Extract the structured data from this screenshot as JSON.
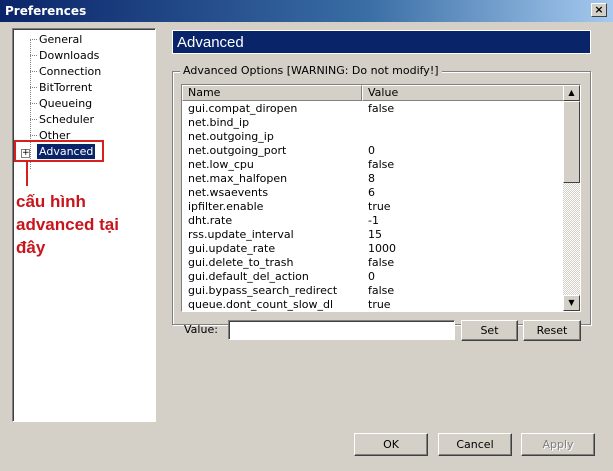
{
  "window": {
    "title": "Preferences",
    "close_glyph": "×"
  },
  "tree": {
    "items": [
      {
        "label": "General"
      },
      {
        "label": "Downloads"
      },
      {
        "label": "Connection"
      },
      {
        "label": "BitTorrent"
      },
      {
        "label": "Queueing"
      },
      {
        "label": "Scheduler"
      },
      {
        "label": "Other"
      },
      {
        "label": "Advanced",
        "selected": true
      }
    ],
    "expander_glyph": "+"
  },
  "annotation": {
    "text_line1": "cấu hình",
    "text_line2": "advanced tại",
    "text_line3": "đây",
    "color": "#c8151b"
  },
  "header": {
    "title": "Advanced"
  },
  "options": {
    "group_title": "Advanced Options [WARNING: Do not modify!]",
    "columns": {
      "name": "Name",
      "value": "Value"
    },
    "rows": [
      {
        "name": "gui.compat_diropen",
        "value": "false"
      },
      {
        "name": "net.bind_ip",
        "value": ""
      },
      {
        "name": "net.outgoing_ip",
        "value": ""
      },
      {
        "name": "net.outgoing_port",
        "value": "0"
      },
      {
        "name": "net.low_cpu",
        "value": "false"
      },
      {
        "name": "net.max_halfopen",
        "value": "8"
      },
      {
        "name": "net.wsaevents",
        "value": "6"
      },
      {
        "name": "ipfilter.enable",
        "value": "true"
      },
      {
        "name": "dht.rate",
        "value": "-1"
      },
      {
        "name": "rss.update_interval",
        "value": "15"
      },
      {
        "name": "gui.update_rate",
        "value": "1000"
      },
      {
        "name": "gui.delete_to_trash",
        "value": "false"
      },
      {
        "name": "gui.default_del_action",
        "value": "0"
      },
      {
        "name": "gui.bypass_search_redirect",
        "value": "false"
      },
      {
        "name": "queue.dont_count_slow_dl",
        "value": "true"
      }
    ]
  },
  "value_editor": {
    "label": "Value:",
    "value": "",
    "set_label": "Set",
    "reset_label": "Reset"
  },
  "footer": {
    "ok_label": "OK",
    "cancel_label": "Cancel",
    "apply_label": "Apply"
  },
  "colors": {
    "title_bar": "#0a246a",
    "header_bg": "#0a246a",
    "selection": "#0a246a",
    "annotation": "#c8151b"
  }
}
